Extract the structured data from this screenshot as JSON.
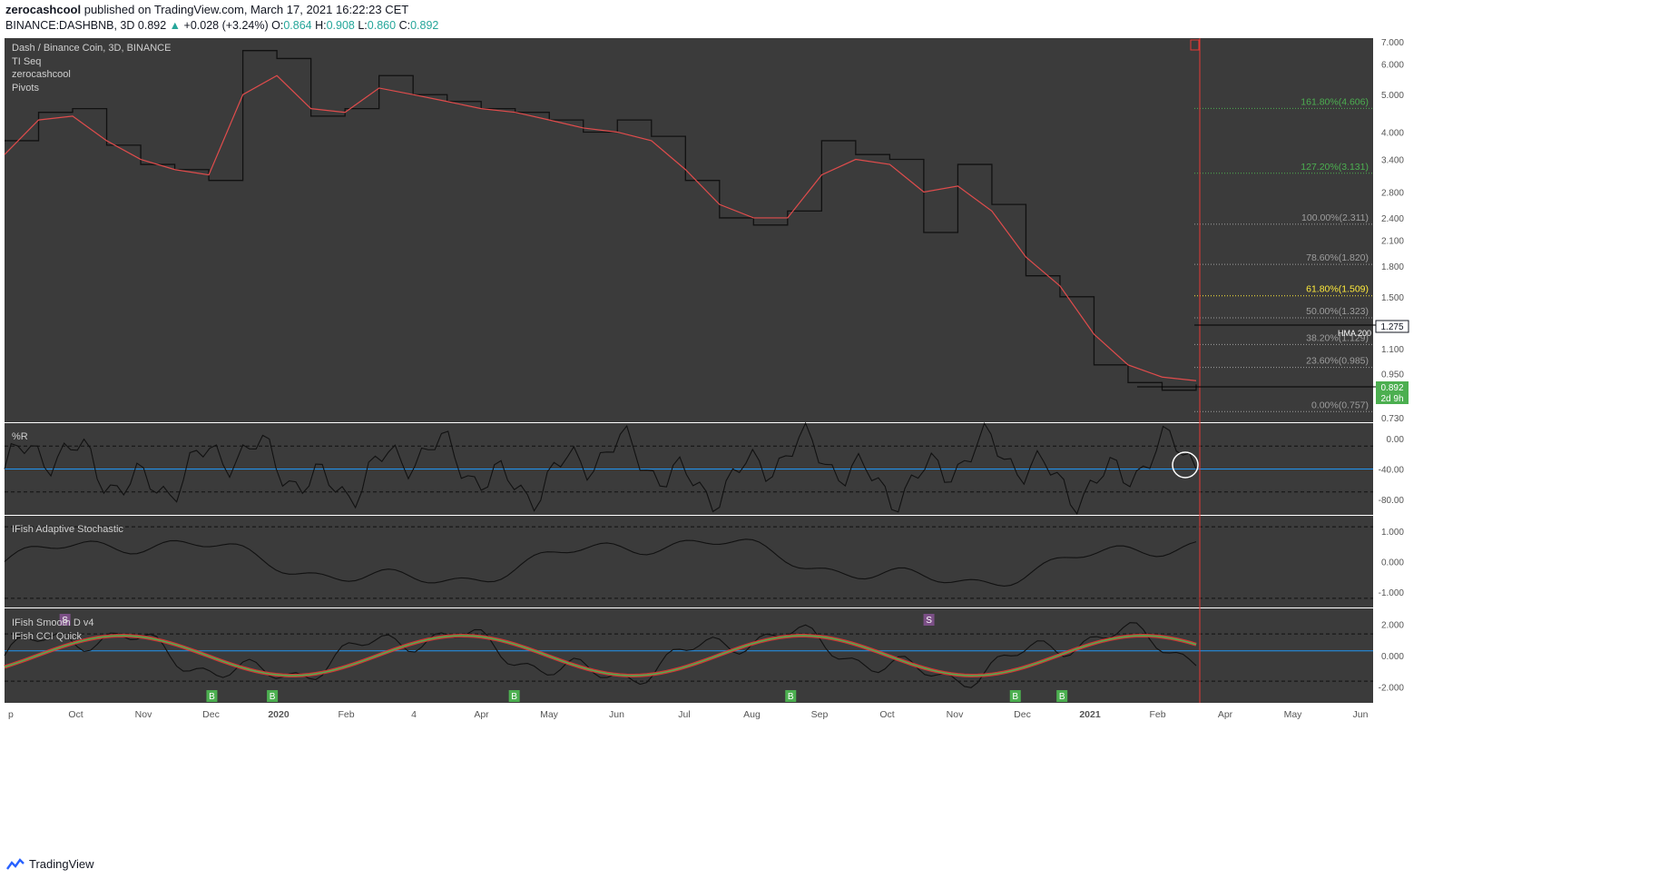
{
  "header": {
    "author": "zerocashcool",
    "published_text": "published on TradingView.com, March 17, 2021 16:22:23 CET",
    "symbol": "BINANCE:DASHBNB, 3D",
    "last": "0.892",
    "change": "+0.028 (+3.24%)",
    "o_label": "O:",
    "o": "0.864",
    "h_label": "H:",
    "h": "0.908",
    "l_label": "L:",
    "l": "0.860",
    "c_label": "C:",
    "c": "0.892"
  },
  "legend": {
    "title": "Dash / Binance Coin, 3D, BINANCE",
    "items": [
      "TI Seq",
      "zerocashcool",
      "Pivots"
    ]
  },
  "pane_titles": {
    "williams": "%R",
    "ifish_stoch": "IFish Adaptive Stochastic",
    "ifish_smooth": "IFish Smooth D v4",
    "ifish_cci": "IFish CCI Quick"
  },
  "price_axis_labels": [
    "7.000",
    "6.000",
    "5.000",
    "4.000",
    "3.400",
    "2.800",
    "2.400",
    "2.100",
    "1.800",
    "1.500",
    "1.100",
    "0.950",
    "0.730"
  ],
  "badges": {
    "hma_label": "HMA 200",
    "hma_value": "1.275",
    "price": "0.892",
    "countdown": "2d 9h"
  },
  "fib_levels": [
    {
      "label": "161.80%(4.606)",
      "value": 4.606,
      "color": "#4caf50"
    },
    {
      "label": "127.20%(3.131)",
      "value": 3.131,
      "color": "#4caf50"
    },
    {
      "label": "100.00%(2.311)",
      "value": 2.311,
      "color": "#9e9e9e"
    },
    {
      "label": "78.60%(1.820)",
      "value": 1.82,
      "color": "#9e9e9e"
    },
    {
      "label": "61.80%(1.509)",
      "value": 1.509,
      "color": "#ffeb3b"
    },
    {
      "label": "50.00%(1.323)",
      "value": 1.323,
      "color": "#9e9e9e"
    },
    {
      "label": "38.20%(1.129)",
      "value": 1.129,
      "color": "#9e9e9e"
    },
    {
      "label": "23.60%(0.985)",
      "value": 0.985,
      "color": "#9e9e9e"
    },
    {
      "label": "0.00%(0.757)",
      "value": 0.757,
      "color": "#9e9e9e"
    }
  ],
  "williams_axis": [
    "0.00",
    "-40.00",
    "-80.00"
  ],
  "stoch_axis": [
    "1.000",
    "0.000",
    "-1.000"
  ],
  "smooth_axis": [
    "2.000",
    "0.000",
    "-2.000"
  ],
  "time_axis": [
    "p",
    "Oct",
    "Nov",
    "Dec",
    "2020",
    "Feb",
    "4",
    "Apr",
    "May",
    "Jun",
    "Jul",
    "Aug",
    "Sep",
    "Oct",
    "Nov",
    "Dec",
    "2021",
    "Feb",
    "Apr",
    "May",
    "Jun"
  ],
  "signals": [
    {
      "text": "S",
      "pos": 0.035
    },
    {
      "text": "B",
      "pos": 0.12
    },
    {
      "text": "B",
      "pos": 0.155
    },
    {
      "text": "B",
      "pos": 0.295
    },
    {
      "text": "B",
      "pos": 0.455
    },
    {
      "text": "S",
      "pos": 0.535
    },
    {
      "text": "B",
      "pos": 0.585
    },
    {
      "text": "B",
      "pos": 0.612
    }
  ],
  "footer": {
    "brand": "TradingView"
  },
  "colors": {
    "bg": "#3b3b3b",
    "axis_bg": "#ffffff",
    "ema": "#e04c4c",
    "green": "#4caf50",
    "blue": "#2196f3",
    "red_line": "#e53935",
    "up": "#26a69a"
  },
  "chart_data": {
    "type": "line",
    "title": "Dash / Binance Coin, 3D, BINANCE",
    "x": [
      "p",
      "Oct",
      "Nov",
      "Dec",
      "2020",
      "Feb",
      "4",
      "Apr",
      "May",
      "Jun",
      "Jul",
      "Aug",
      "Sep",
      "Oct",
      "Nov",
      "Dec",
      "2021",
      "Feb"
    ],
    "series": [
      {
        "values": [
          3.8,
          4.5,
          4.6,
          3.7,
          3.3,
          3.2,
          3.0,
          6.5,
          6.2,
          4.4,
          4.6,
          5.6,
          5.0,
          4.8,
          4.6,
          4.5,
          4.3,
          4.0,
          4.3,
          3.9,
          3.0,
          2.4,
          2.3,
          2.5,
          3.8,
          3.5,
          3.4,
          2.2,
          3.3,
          2.6,
          1.7,
          1.5,
          1.0,
          0.9,
          0.86,
          0.89
        ]
      },
      {
        "values": [
          3.5,
          4.3,
          4.4,
          3.8,
          3.4,
          3.2,
          3.1,
          5.0,
          5.6,
          4.6,
          4.5,
          5.2,
          5.0,
          4.8,
          4.6,
          4.5,
          4.3,
          4.1,
          4.0,
          3.8,
          3.2,
          2.6,
          2.4,
          2.4,
          3.1,
          3.4,
          3.3,
          2.8,
          2.9,
          2.5,
          1.9,
          1.6,
          1.2,
          1.0,
          0.93,
          0.91
        ]
      }
    ],
    "ylim": [
      0.73,
      7.0
    ],
    "log_scale": true,
    "grid": false
  }
}
